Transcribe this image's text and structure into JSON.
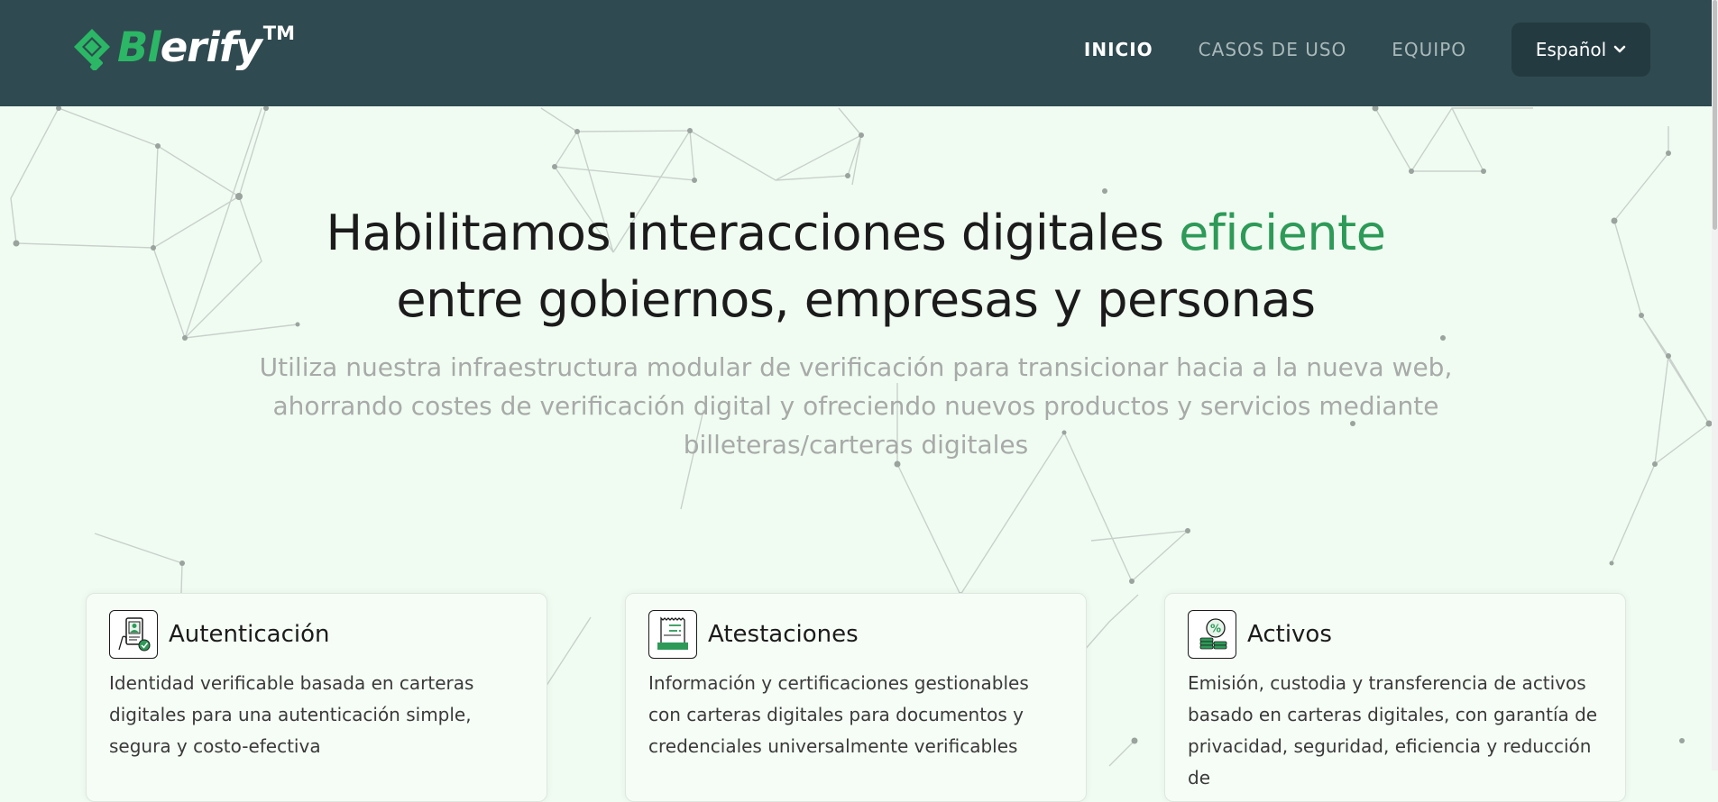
{
  "brand": {
    "prefix": "Bl",
    "rest": "erify",
    "trademark": "TM"
  },
  "nav": {
    "links": [
      "INICIO",
      "CASOS DE USO",
      "EQUIPO"
    ],
    "language": "Español"
  },
  "hero": {
    "title_line1_before": "Habilitamos interacciones digitales",
    "title_highlight": "eficiente",
    "title_line2": "entre gobiernos, empresas y personas",
    "subtitle": "Utiliza nuestra infraestructura modular de verificación para transicionar hacia a la nueva web, ahorrando costes de verificación digital y ofreciendo nuevos productos y servicios mediante billeteras/carteras digitales"
  },
  "cards": [
    {
      "title": "Autenticación",
      "icon": "id-verification-icon",
      "description": "Identidad verificable basada en carteras digitales para una autenticación simple, segura y costo-efectiva"
    },
    {
      "title": "Atestaciones",
      "icon": "document-certificate-icon",
      "description": "Información y certificaciones gestionables con carteras digitales para documentos y credenciales universalmente verificables"
    },
    {
      "title": "Activos",
      "icon": "coins-percent-icon",
      "description": "Emisión, custodia y transferencia de activos basado en carteras digitales, con garantía de privacidad, seguridad, eficiencia y reducción de"
    }
  ],
  "colors": {
    "navbar": "#2f4a50",
    "accent_green": "#2d9a58",
    "page_background": "#f0fcf1"
  }
}
